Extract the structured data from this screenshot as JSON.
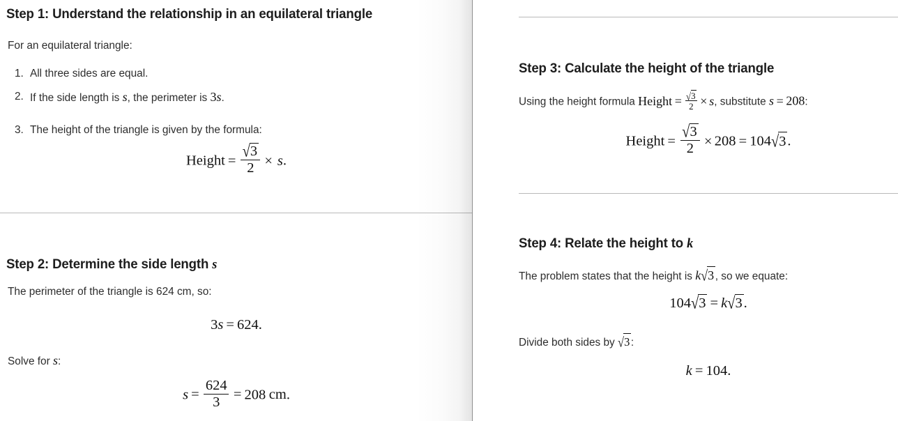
{
  "document": {
    "type": "math-solution",
    "layout": "two-column-paginated",
    "topic": "Equilateral triangle height and k"
  },
  "columns": {
    "left": {
      "steps": [
        {
          "heading": "Step 1: Understand the relationship in an equilateral triangle",
          "intro": "For an equilateral triangle:",
          "list": [
            {
              "marker": "1.",
              "text": "All three sides are equal."
            },
            {
              "marker": "2.",
              "text_before": "If the side length is ",
              "math_1": "s",
              "text_mid": ", the perimeter is ",
              "math_2_coef": "3",
              "math_2_var": "s",
              "text_after": "."
            },
            {
              "marker": "3.",
              "text": "The height of the triangle is given by the formula:"
            }
          ],
          "display_equation": {
            "lhs": "Height",
            "equals": "=",
            "frac_num_radicand": "3",
            "frac_den": "2",
            "times": "×",
            "rhs_var": "s",
            "period": "."
          }
        },
        {
          "heading_before": "Step 2: Determine the side length ",
          "heading_math": "s",
          "para_1": "The perimeter of the triangle is 624 cm, so:",
          "equation_1": {
            "coef": "3",
            "var": "s",
            "equals": "=",
            "value": "624",
            "period": "."
          },
          "para_2_before": "Solve for ",
          "para_2_math": "s",
          "para_2_after": ":",
          "equation_2": {
            "var": "s",
            "equals": "=",
            "frac_num": "624",
            "frac_den": "3",
            "equals_2": "=",
            "value": "208",
            "unit": "cm",
            "period": "."
          }
        }
      ]
    },
    "right": {
      "steps": [
        {
          "heading": "Step 3: Calculate the height of the triangle",
          "para_before": "Using the height formula ",
          "inline_formula": {
            "lhs": "Height",
            "equals": "=",
            "frac_num_radicand": "3",
            "frac_den": "2",
            "times": "×",
            "var": "s"
          },
          "para_mid": ", substitute ",
          "inline_sub": {
            "var": "s",
            "equals": "=",
            "value": "208"
          },
          "para_after": ":",
          "display_equation": {
            "lhs": "Height",
            "equals": "=",
            "frac_num_radicand": "3",
            "frac_den": "2",
            "times": "×",
            "value": "208",
            "equals_2": "=",
            "result_coef": "104",
            "result_radicand": "3",
            "period": "."
          }
        },
        {
          "heading_before": "Step 4: Relate the height to ",
          "heading_math": "k",
          "para_1_before": "The problem states that the height is ",
          "para_1_math": {
            "coef": "k",
            "radicand": "3"
          },
          "para_1_after": ", so we equate:",
          "equation_1": {
            "lhs_coef": "104",
            "lhs_radicand": "3",
            "equals": "=",
            "rhs_coef": "k",
            "rhs_radicand": "3",
            "period": "."
          },
          "para_2_before": "Divide both sides by ",
          "para_2_math_radicand": "3",
          "para_2_after": ":",
          "equation_2": {
            "var": "k",
            "equals": "=",
            "value": "104",
            "period": "."
          }
        }
      ]
    }
  },
  "symbols": {
    "radical": "√",
    "times": "×",
    "equals": "="
  },
  "colors": {
    "heading": "#1d1d1d",
    "body": "#2d2d2d",
    "math": "#111111",
    "rule": "#b9b9b9",
    "page_edge": "#8e8e8e",
    "background": "#ffffff"
  }
}
